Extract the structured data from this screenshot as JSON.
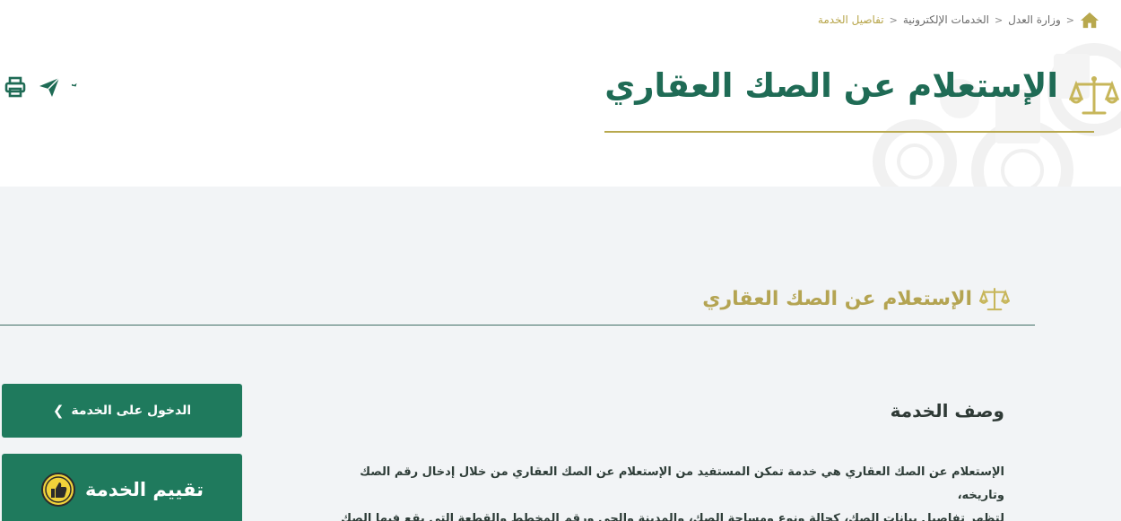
{
  "breadcrumb": {
    "items": [
      "وزارة العدل",
      "الخدمات الإلكترونية",
      "تفاصيل الخدمة"
    ]
  },
  "header": {
    "title": "الإستعلام عن الصك العقاري"
  },
  "section": {
    "title": "الإستعلام عن الصك العقاري"
  },
  "actions": {
    "enter_label": "الدخول على الخدمة",
    "rate_label": "تقييم الخدمة"
  },
  "description": {
    "title": "وصف الخدمة",
    "line1": "الإستعلام عن الصك العقاري هي خدمة تمكن المستفيد من الإستعلام عن الصك العقاري  من خلال إدخال رقم الصك وتاريخه،",
    "line2": "لتظهر تفاصيل بيانات الصك، كحالة ونوع ومساحة الصك، والمدينة والحي ورقم المخطط والقطعة التي يقع فيها الصك"
  },
  "icons": {
    "home": "home-icon",
    "print": "print-icon",
    "share": "share-icon",
    "favorite": "star-icon",
    "scale": "scale-icon",
    "thumb": "thumb-up-icon"
  },
  "colors": {
    "primary_green": "#1f7a5d",
    "title_green": "#1f6b55",
    "gold": "#b8a84d",
    "background": "#f2f4f6"
  }
}
